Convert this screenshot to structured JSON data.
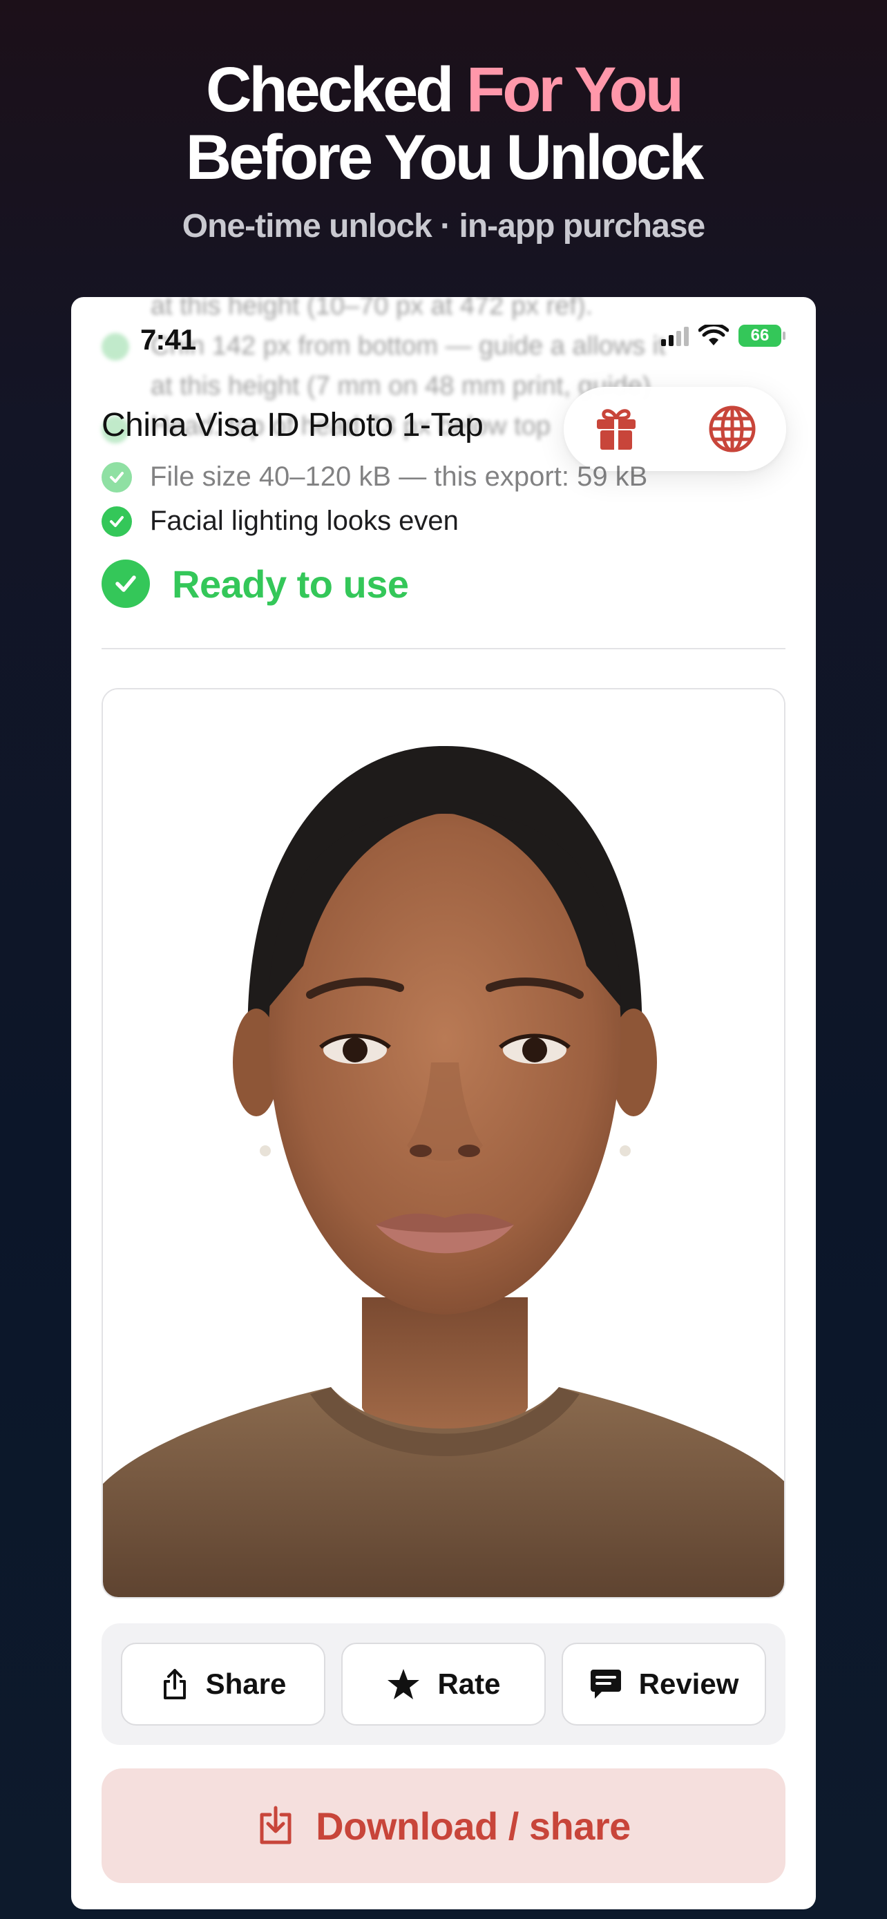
{
  "hero": {
    "line1_main": "Checked ",
    "line1_accent": "For You",
    "line2": "Before You Unlock",
    "subtitle": "One-time unlock · in-app purchase"
  },
  "status_bar": {
    "time": "7:41",
    "battery": "66"
  },
  "header": {
    "title": "China Visa ID Photo 1-Tap"
  },
  "blurred_list": [
    "at this height (10–70 px at 472 px ref).",
    "Chin 142 px from bottom — guide a allows it",
    "at this height (7 mm on 48 mm print, guide)",
    "Head: top of head 73 px below top"
  ],
  "checks": [
    {
      "label": "File size 40–120 kB — this export: 59 kB"
    },
    {
      "label": "Facial lighting looks even"
    }
  ],
  "ready": {
    "label": "Ready to use"
  },
  "actions": {
    "share": "Share",
    "rate": "Rate",
    "review": "Review"
  },
  "download": {
    "label": "Download / share"
  },
  "colors": {
    "accent_pink": "#ff97aa",
    "success_green": "#34c759",
    "brand_red": "#c8453a",
    "download_bg": "#f5dfdd"
  },
  "icons": [
    "gift-icon",
    "globe-icon",
    "share-icon",
    "star-icon",
    "review-icon",
    "download-icon",
    "check-icon"
  ]
}
